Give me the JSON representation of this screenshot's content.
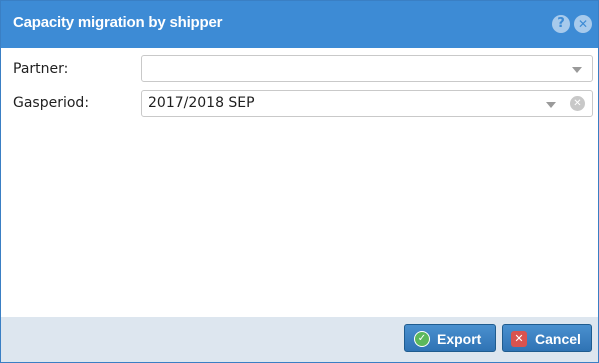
{
  "dialog": {
    "title": "Capacity migration by shipper",
    "help_icon": "?",
    "close_icon": "✕"
  },
  "form": {
    "partner": {
      "label": "Partner:",
      "value": ""
    },
    "gasperiod": {
      "label": "Gasperiod:",
      "value": "2017/2018 SEP",
      "clear_icon": "✕"
    }
  },
  "footer": {
    "export_label": "Export",
    "export_icon": "✓",
    "cancel_label": "Cancel",
    "cancel_icon": "✕"
  },
  "colors": {
    "titlebar": "#3d8bd5",
    "footer": "#dde6ef",
    "button": "#2f73b4",
    "export_icon": "#5cb85c",
    "cancel_icon": "#d9534f"
  },
  "icons": {
    "help": "help-icon",
    "close": "close-icon",
    "dropdown": "chevron-down-icon",
    "clear": "clear-icon",
    "export": "check-circle-icon",
    "cancel": "cancel-icon"
  }
}
